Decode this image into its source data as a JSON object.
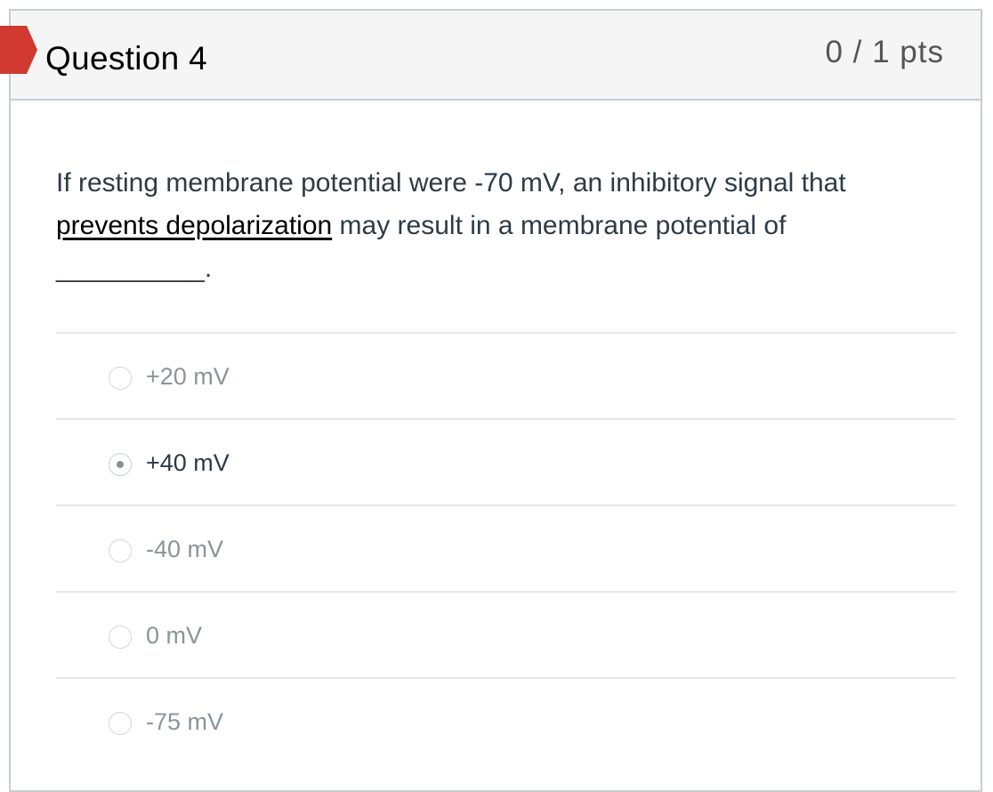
{
  "question": {
    "title": "Question 4",
    "points": "0 / 1 pts",
    "text_part1": "If resting membrane potential were -70 mV, an inhibitory signal that ",
    "text_emphasis": "prevents depolarization",
    "text_part2": " may result in a membrane potential of __________.",
    "flag_color": "#d0392f"
  },
  "answers": [
    {
      "label": "+20 mV",
      "selected": false
    },
    {
      "label": "+40 mV",
      "selected": true
    },
    {
      "label": "-40 mV",
      "selected": false
    },
    {
      "label": "0 mV",
      "selected": false
    },
    {
      "label": "-75 mV",
      "selected": false
    }
  ]
}
